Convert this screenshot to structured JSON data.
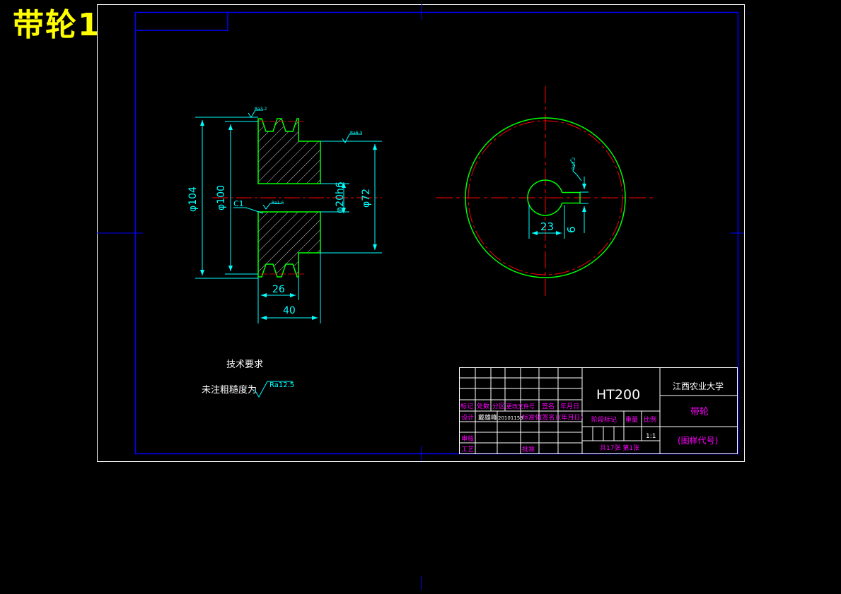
{
  "sheet_title": "带轮1",
  "dimensions": {
    "d104": "φ104",
    "d100": "φ100",
    "c1": "C1",
    "d20": "φ20h6",
    "d72": "φ72",
    "w26": "26",
    "w40": "40",
    "w23": "23",
    "w6": "6"
  },
  "roughness": {
    "rim": "Ra3.2",
    "hub": "Ra6.3",
    "bore": "Ra1.6",
    "keyway": "Ra3.2",
    "default": "Ra12.5"
  },
  "tech": {
    "heading": "技术要求",
    "note": "未注粗糙度为"
  },
  "title_block": {
    "material": "HT200",
    "school": "江西农业大学",
    "part_name": "带轮",
    "drawing_no": "(图样代号)",
    "row_labels": [
      "标记",
      "处数",
      "分区",
      "更改文件号",
      "签名",
      "年月日"
    ],
    "design_label": "设计",
    "designer": "戴雄峰",
    "student_id": "20101153",
    "std_label": "标准化",
    "sign_label": "(签名)",
    "date_label": "(年月日)",
    "stage_label": "阶段标记",
    "weight_label": "重量",
    "scale_label": "比例",
    "scale": "1:1",
    "review_label": "审核",
    "process_label": "工艺",
    "approve_label": "批准",
    "sheets": "共17张 第1张"
  },
  "colors": {
    "frame": "#0000ff",
    "border": "#ffffff",
    "outline": "#00ff00",
    "center": "#ff0000",
    "dimension": "#00ffff",
    "label": "#ff00ff",
    "title": "#ffff00"
  }
}
